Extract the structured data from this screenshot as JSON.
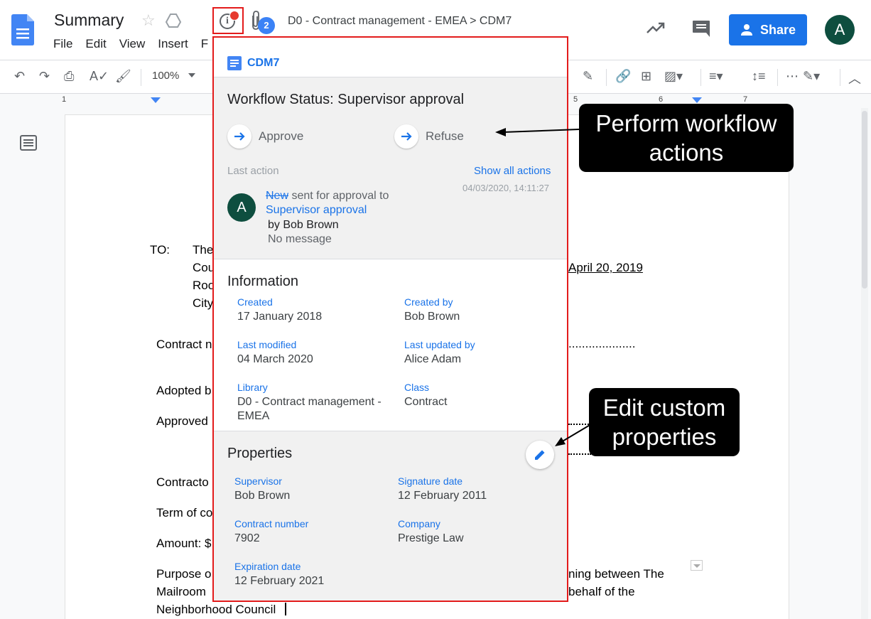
{
  "header": {
    "doc_title": "Summary",
    "menu": [
      "File",
      "Edit",
      "View",
      "Insert",
      "F"
    ],
    "attachments_count": "2",
    "breadcrumb": "D0 - Contract management - EMEA  >  CDM7",
    "share_label": "Share",
    "avatar_initial": "A"
  },
  "toolbar": {
    "zoom": "100%"
  },
  "ruler": [
    "1",
    "5",
    "6",
    "7"
  ],
  "document": {
    "to_label": "TO:",
    "to_lines": [
      "The",
      "Cou",
      "Roo",
      "City"
    ],
    "date": "April 20, 2019",
    "contract_line": "Contract n",
    "dots_1": "....................",
    "adopted": "Adopted b",
    "approved": "Approved",
    "contractor": "Contracto",
    "term": "Term of co",
    "amount": "Amount: $",
    "purpose_l1_a": "Purpose o",
    "purpose_l1_b": "ning between The",
    "purpose_l2_a": "Mailroom",
    "purpose_l2_b": "behalf of the",
    "purpose_l3": "Neighborhood Council"
  },
  "panel": {
    "doc_name": "CDM7",
    "workflow": {
      "title": "Workflow Status: Supervisor approval",
      "actions": [
        "Approve",
        "Refuse"
      ],
      "last_action_label": "Last action",
      "show_all_label": "Show all actions",
      "timestamp": "04/03/2020, 14:11:27",
      "avatar_initial": "A",
      "from_state": "New",
      "sent_text": " sent for approval to",
      "to_state": "Supervisor approval",
      "by_line": "by Bob Brown",
      "message": "No message"
    },
    "information": {
      "title": "Information",
      "fields": [
        {
          "label": "Created",
          "value": "17 January 2018"
        },
        {
          "label": "Created by",
          "value": "Bob Brown"
        },
        {
          "label": "Last modified",
          "value": "04 March 2020"
        },
        {
          "label": "Last updated by",
          "value": "Alice Adam"
        },
        {
          "label": "Library",
          "value": "D0 - Contract management - EMEA"
        },
        {
          "label": "Class",
          "value": "Contract"
        }
      ]
    },
    "properties": {
      "title": "Properties",
      "fields": [
        {
          "label": "Supervisor",
          "value": "Bob Brown"
        },
        {
          "label": "Signature date",
          "value": "12 February 2011"
        },
        {
          "label": "Contract number",
          "value": "7902"
        },
        {
          "label": "Company",
          "value": "Prestige Law"
        },
        {
          "label": "Expiration date",
          "value": "12 February 2021"
        }
      ]
    }
  },
  "callouts": {
    "workflow_l1": "Perform workflow",
    "workflow_l2": "actions",
    "edit_l1": "Edit custom",
    "edit_l2": "properties"
  },
  "colors": {
    "accent": "#1a73e8",
    "highlight_border": "#e31b1b",
    "avatar": "#0e4e3f"
  }
}
